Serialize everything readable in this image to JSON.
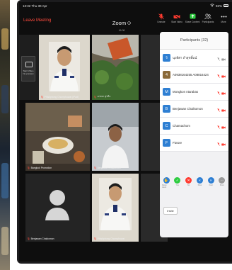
{
  "status_bar": {
    "time": "13:32",
    "date": "Thu 30 Apr",
    "battery": "92%"
  },
  "toolbar": {
    "leave_label": "Leave Meeting",
    "title": "Zoom",
    "subtitle": "16:08",
    "actions": [
      {
        "label": "Unmute",
        "icon": "mic-muted-icon",
        "color": "#ff3b30"
      },
      {
        "label": "Start Video",
        "icon": "video-off-icon",
        "color": "#ff3b30"
      },
      {
        "label": "Share Content",
        "icon": "share-icon",
        "color": "#2ecc40"
      },
      {
        "label": "Participants",
        "icon": "participants-icon",
        "color": "#e8e8e8"
      },
      {
        "label": "More",
        "icon": "more-icon",
        "color": "#e8e8e8"
      }
    ]
  },
  "self_view": {
    "caption_line1": "Start Video",
    "caption_line2": "No preview"
  },
  "tiles": [
    {
      "name": "Phisitphong Chomphuwat (iPad)",
      "type": "person-uniform"
    },
    {
      "name": "อารยา สุขใจ",
      "type": "plants"
    },
    {
      "name": "",
      "type": "empty"
    },
    {
      "name": "Bangkok Promotion",
      "type": "food"
    },
    {
      "name": "Benjawan Chaikomon",
      "type": "person-girl"
    },
    {
      "name": "",
      "type": "empty"
    },
    {
      "name": "Benjawan Chaikomon",
      "type": "avatar"
    },
    {
      "name": "Phisitphong Chomphuwat",
      "type": "person-uniform"
    },
    {
      "name": "",
      "type": "empty"
    }
  ],
  "participants_panel": {
    "title": "Participants (32)",
    "participants": [
      {
        "initial": "ร",
        "name": "นุรติศา ถำสุขทิ้มน์",
        "color": "#2e7fd3"
      },
      {
        "initial": "4",
        "name": "A0938164255 A08816424",
        "color": "#8a6a3a"
      },
      {
        "initial": "M",
        "name": "Mongkon ntarakas",
        "color": "#2e7fd3"
      },
      {
        "initial": "B",
        "name": "Benjawan Chaikomon",
        "color": "#2e7fd3"
      },
      {
        "initial": "C",
        "name": "Chamachom",
        "color": "#2e7fd3"
      },
      {
        "initial": "F",
        "name": "Fiwore",
        "color": "#2e7fd3"
      }
    ],
    "reactions": [
      {
        "label": "Raise Hand",
        "color": "#2e7fd3",
        "glyph": "✋"
      },
      {
        "label": "Yes",
        "color": "#2ecc40",
        "glyph": "✓"
      },
      {
        "label": "No",
        "color": "#ff3b30",
        "glyph": "✕"
      },
      {
        "label": "Slow",
        "color": "#2e7fd3",
        "glyph": "«"
      },
      {
        "label": "Fast",
        "color": "#2e7fd3",
        "glyph": "»"
      },
      {
        "label": "More",
        "color": "#9a9a9a",
        "glyph": "⋯"
      }
    ],
    "invite_label": "Invite"
  }
}
